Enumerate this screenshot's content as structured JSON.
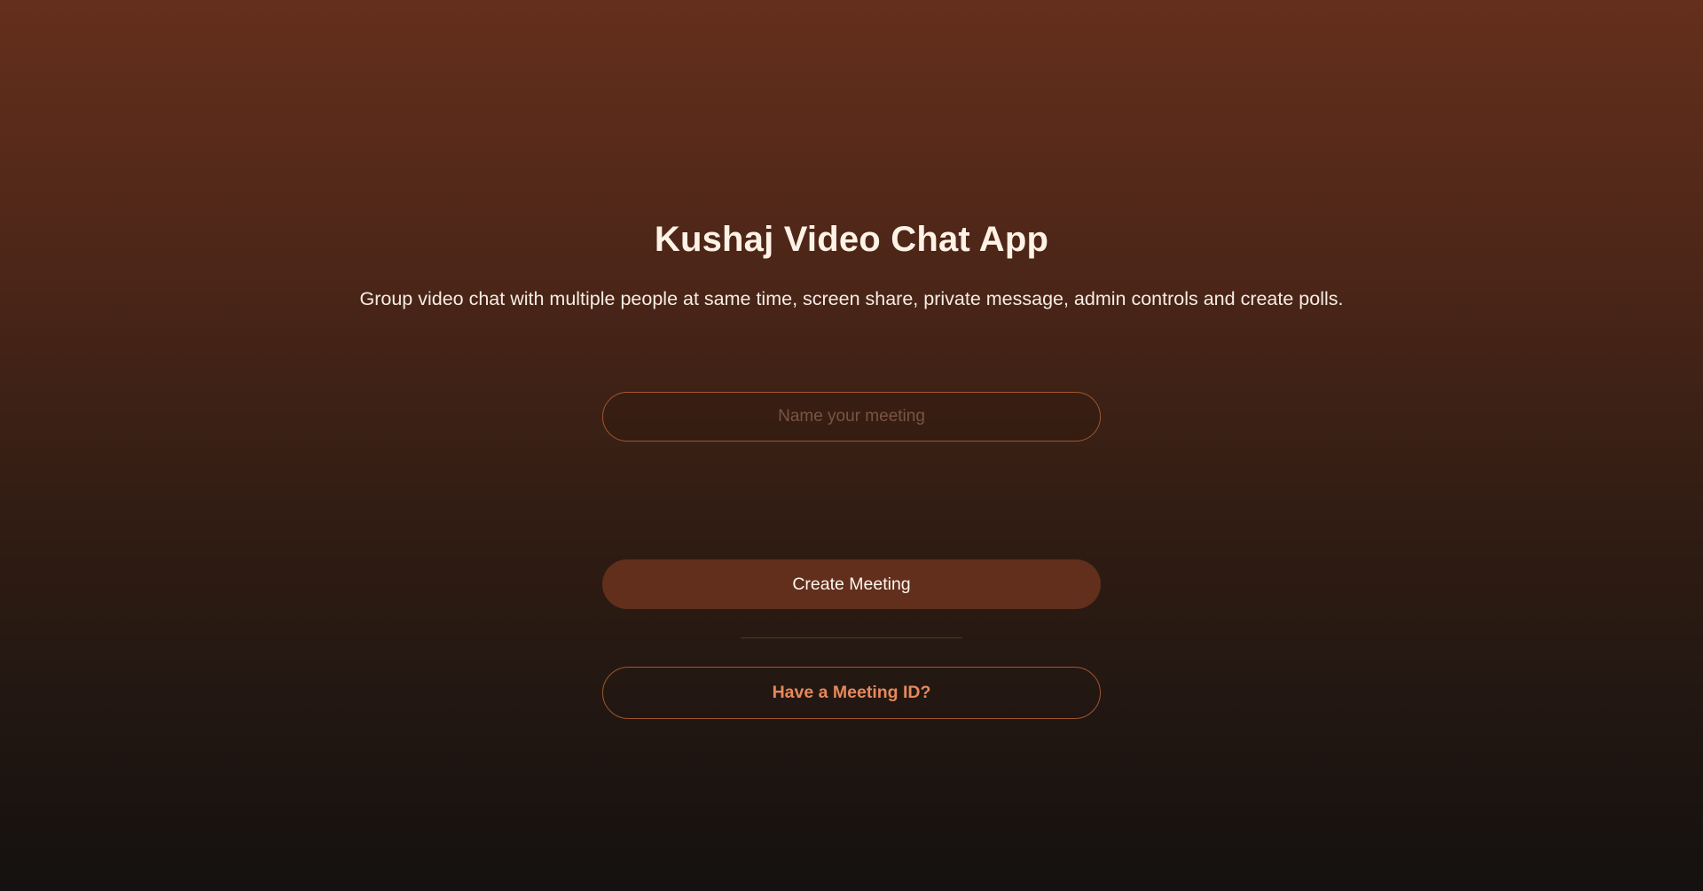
{
  "home": {
    "title": "Kushaj Video Chat App",
    "subtitle": "Group video chat with multiple people at same time, screen share, private message, admin controls and create polls.",
    "meeting_name_input": {
      "value": "",
      "placeholder": "Name your meeting"
    },
    "create_button_label": "Create Meeting",
    "join_button_label": "Have a Meeting ID?"
  },
  "colors": {
    "background_top": "#652f1c",
    "background_bottom": "#141110",
    "accent": "#e6885c",
    "button_fill": "#612f1c",
    "border": "#a0562e"
  }
}
